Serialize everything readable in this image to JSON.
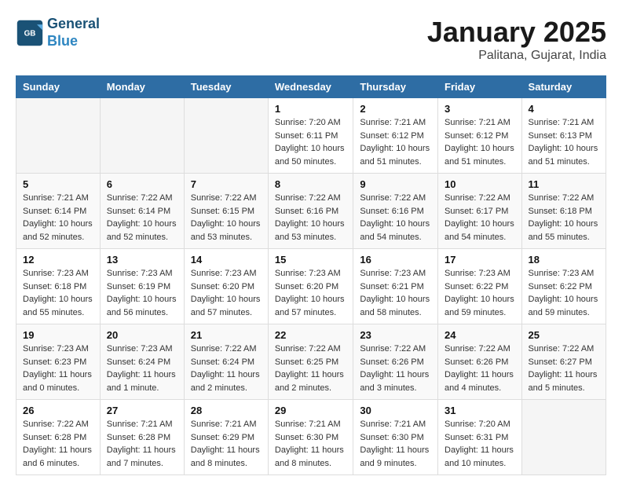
{
  "header": {
    "logo_line1": "General",
    "logo_line2": "Blue",
    "month": "January 2025",
    "location": "Palitana, Gujarat, India"
  },
  "weekdays": [
    "Sunday",
    "Monday",
    "Tuesday",
    "Wednesday",
    "Thursday",
    "Friday",
    "Saturday"
  ],
  "weeks": [
    [
      {
        "day": "",
        "info": ""
      },
      {
        "day": "",
        "info": ""
      },
      {
        "day": "",
        "info": ""
      },
      {
        "day": "1",
        "info": "Sunrise: 7:20 AM\nSunset: 6:11 PM\nDaylight: 10 hours\nand 50 minutes."
      },
      {
        "day": "2",
        "info": "Sunrise: 7:21 AM\nSunset: 6:12 PM\nDaylight: 10 hours\nand 51 minutes."
      },
      {
        "day": "3",
        "info": "Sunrise: 7:21 AM\nSunset: 6:12 PM\nDaylight: 10 hours\nand 51 minutes."
      },
      {
        "day": "4",
        "info": "Sunrise: 7:21 AM\nSunset: 6:13 PM\nDaylight: 10 hours\nand 51 minutes."
      }
    ],
    [
      {
        "day": "5",
        "info": "Sunrise: 7:21 AM\nSunset: 6:14 PM\nDaylight: 10 hours\nand 52 minutes."
      },
      {
        "day": "6",
        "info": "Sunrise: 7:22 AM\nSunset: 6:14 PM\nDaylight: 10 hours\nand 52 minutes."
      },
      {
        "day": "7",
        "info": "Sunrise: 7:22 AM\nSunset: 6:15 PM\nDaylight: 10 hours\nand 53 minutes."
      },
      {
        "day": "8",
        "info": "Sunrise: 7:22 AM\nSunset: 6:16 PM\nDaylight: 10 hours\nand 53 minutes."
      },
      {
        "day": "9",
        "info": "Sunrise: 7:22 AM\nSunset: 6:16 PM\nDaylight: 10 hours\nand 54 minutes."
      },
      {
        "day": "10",
        "info": "Sunrise: 7:22 AM\nSunset: 6:17 PM\nDaylight: 10 hours\nand 54 minutes."
      },
      {
        "day": "11",
        "info": "Sunrise: 7:22 AM\nSunset: 6:18 PM\nDaylight: 10 hours\nand 55 minutes."
      }
    ],
    [
      {
        "day": "12",
        "info": "Sunrise: 7:23 AM\nSunset: 6:18 PM\nDaylight: 10 hours\nand 55 minutes."
      },
      {
        "day": "13",
        "info": "Sunrise: 7:23 AM\nSunset: 6:19 PM\nDaylight: 10 hours\nand 56 minutes."
      },
      {
        "day": "14",
        "info": "Sunrise: 7:23 AM\nSunset: 6:20 PM\nDaylight: 10 hours\nand 57 minutes."
      },
      {
        "day": "15",
        "info": "Sunrise: 7:23 AM\nSunset: 6:20 PM\nDaylight: 10 hours\nand 57 minutes."
      },
      {
        "day": "16",
        "info": "Sunrise: 7:23 AM\nSunset: 6:21 PM\nDaylight: 10 hours\nand 58 minutes."
      },
      {
        "day": "17",
        "info": "Sunrise: 7:23 AM\nSunset: 6:22 PM\nDaylight: 10 hours\nand 59 minutes."
      },
      {
        "day": "18",
        "info": "Sunrise: 7:23 AM\nSunset: 6:22 PM\nDaylight: 10 hours\nand 59 minutes."
      }
    ],
    [
      {
        "day": "19",
        "info": "Sunrise: 7:23 AM\nSunset: 6:23 PM\nDaylight: 11 hours\nand 0 minutes."
      },
      {
        "day": "20",
        "info": "Sunrise: 7:23 AM\nSunset: 6:24 PM\nDaylight: 11 hours\nand 1 minute."
      },
      {
        "day": "21",
        "info": "Sunrise: 7:22 AM\nSunset: 6:24 PM\nDaylight: 11 hours\nand 2 minutes."
      },
      {
        "day": "22",
        "info": "Sunrise: 7:22 AM\nSunset: 6:25 PM\nDaylight: 11 hours\nand 2 minutes."
      },
      {
        "day": "23",
        "info": "Sunrise: 7:22 AM\nSunset: 6:26 PM\nDaylight: 11 hours\nand 3 minutes."
      },
      {
        "day": "24",
        "info": "Sunrise: 7:22 AM\nSunset: 6:26 PM\nDaylight: 11 hours\nand 4 minutes."
      },
      {
        "day": "25",
        "info": "Sunrise: 7:22 AM\nSunset: 6:27 PM\nDaylight: 11 hours\nand 5 minutes."
      }
    ],
    [
      {
        "day": "26",
        "info": "Sunrise: 7:22 AM\nSunset: 6:28 PM\nDaylight: 11 hours\nand 6 minutes."
      },
      {
        "day": "27",
        "info": "Sunrise: 7:21 AM\nSunset: 6:28 PM\nDaylight: 11 hours\nand 7 minutes."
      },
      {
        "day": "28",
        "info": "Sunrise: 7:21 AM\nSunset: 6:29 PM\nDaylight: 11 hours\nand 8 minutes."
      },
      {
        "day": "29",
        "info": "Sunrise: 7:21 AM\nSunset: 6:30 PM\nDaylight: 11 hours\nand 8 minutes."
      },
      {
        "day": "30",
        "info": "Sunrise: 7:21 AM\nSunset: 6:30 PM\nDaylight: 11 hours\nand 9 minutes."
      },
      {
        "day": "31",
        "info": "Sunrise: 7:20 AM\nSunset: 6:31 PM\nDaylight: 11 hours\nand 10 minutes."
      },
      {
        "day": "",
        "info": ""
      }
    ]
  ]
}
